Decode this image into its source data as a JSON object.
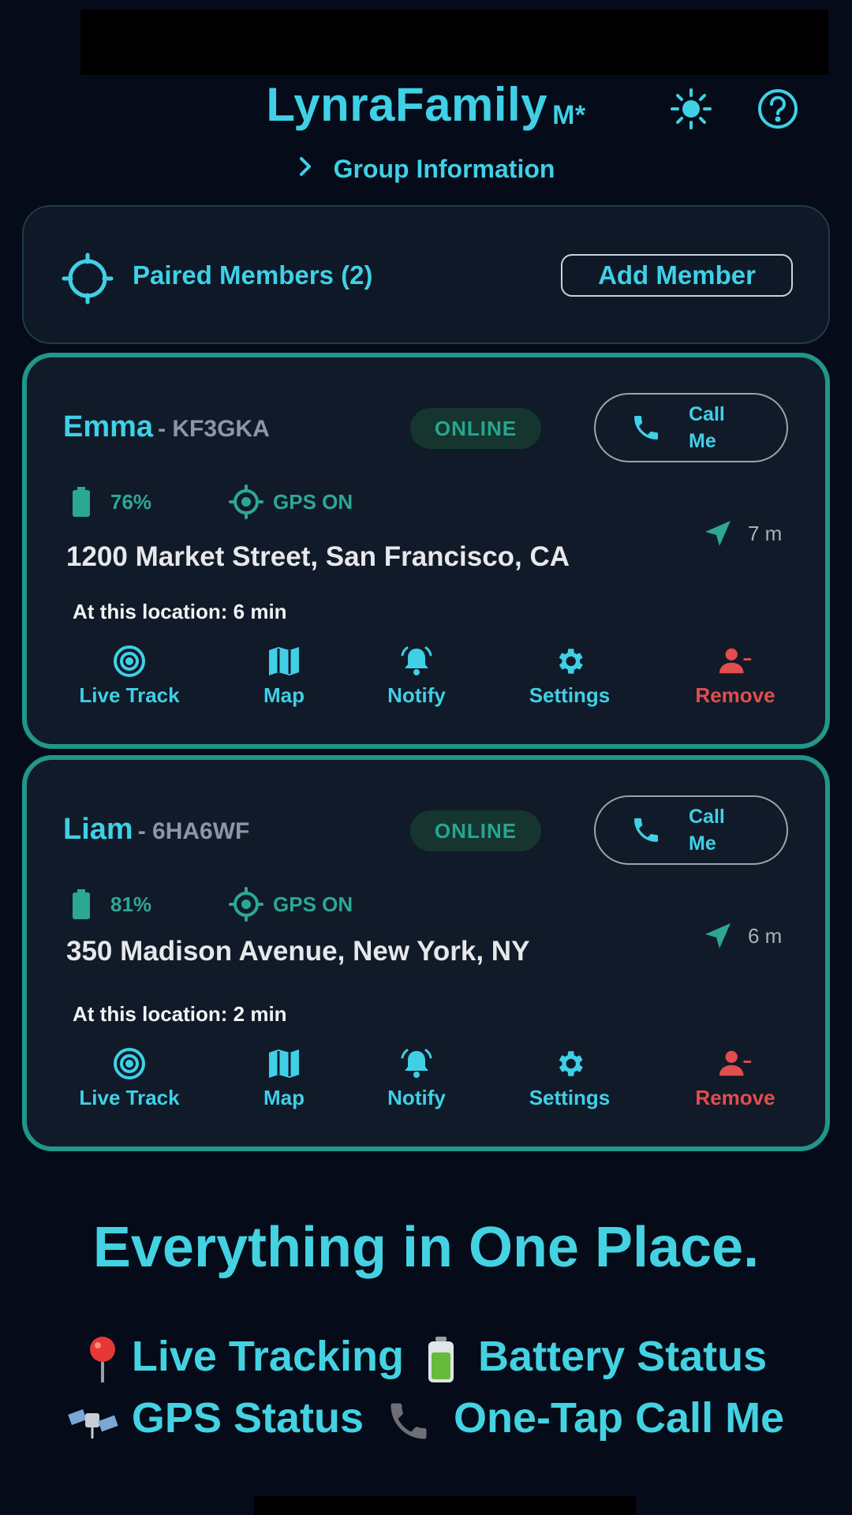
{
  "app": {
    "title": "LynraFamily",
    "badge": "M*"
  },
  "header": {
    "theme_icon": "sun-icon",
    "help_icon": "help-circle-icon"
  },
  "group": {
    "label": "Group Information"
  },
  "paired": {
    "label": "Paired Members (2)",
    "add_button": "Add Member"
  },
  "members": [
    {
      "name": "Emma",
      "code": "- KF3GKA",
      "status": "ONLINE",
      "call_line1": "Call",
      "call_line2": "Me",
      "battery": "76%",
      "gps": "GPS ON",
      "distance": "7 m",
      "address": "1200 Market Street, San Francisco, CA",
      "at_location": "At this location: 6 min"
    },
    {
      "name": "Liam",
      "code": "- 6HA6WF",
      "status": "ONLINE",
      "call_line1": "Call",
      "call_line2": "Me",
      "battery": "81%",
      "gps": "GPS ON",
      "distance": "6 m",
      "address": "350 Madison Avenue, New York, NY",
      "at_location": "At this location: 2 min"
    }
  ],
  "actions": [
    "Live Track",
    "Map",
    "Notify",
    "Settings",
    "Remove"
  ],
  "promo": {
    "title": "Everything in One Place.",
    "line1a": "Live Tracking",
    "line1b": "Battery Status",
    "line2a": "GPS Status",
    "line2b": "One-Tap Call Me"
  },
  "colors": {
    "accent": "#3fd0e6",
    "success": "#27a68f",
    "danger": "#e24d4d",
    "card_border": "#21968a",
    "background": "#050b18"
  }
}
